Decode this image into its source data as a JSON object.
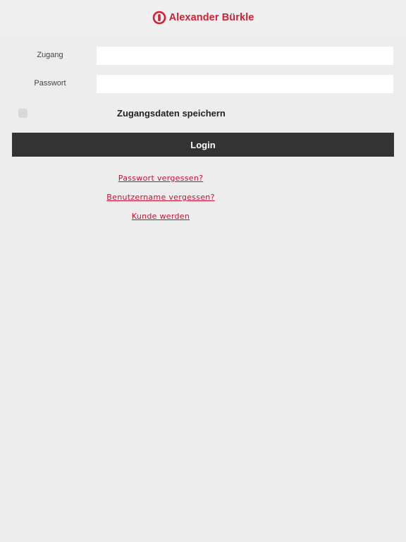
{
  "header": {
    "brand": "Alexander Bürkle",
    "brand_color": "#d41f35",
    "logo_icon": "brand-logo-mark"
  },
  "form": {
    "username_label": "Zugang",
    "username_value": "",
    "password_label": "Passwort",
    "password_value": "",
    "remember_label": "Zugangsdaten speichern",
    "remember_checked": false,
    "login_label": "Login"
  },
  "links": {
    "forgot_password": "Passwort vergessen?",
    "forgot_username": "Benutzername vergessen?",
    "become_customer": "Kunde werden"
  }
}
